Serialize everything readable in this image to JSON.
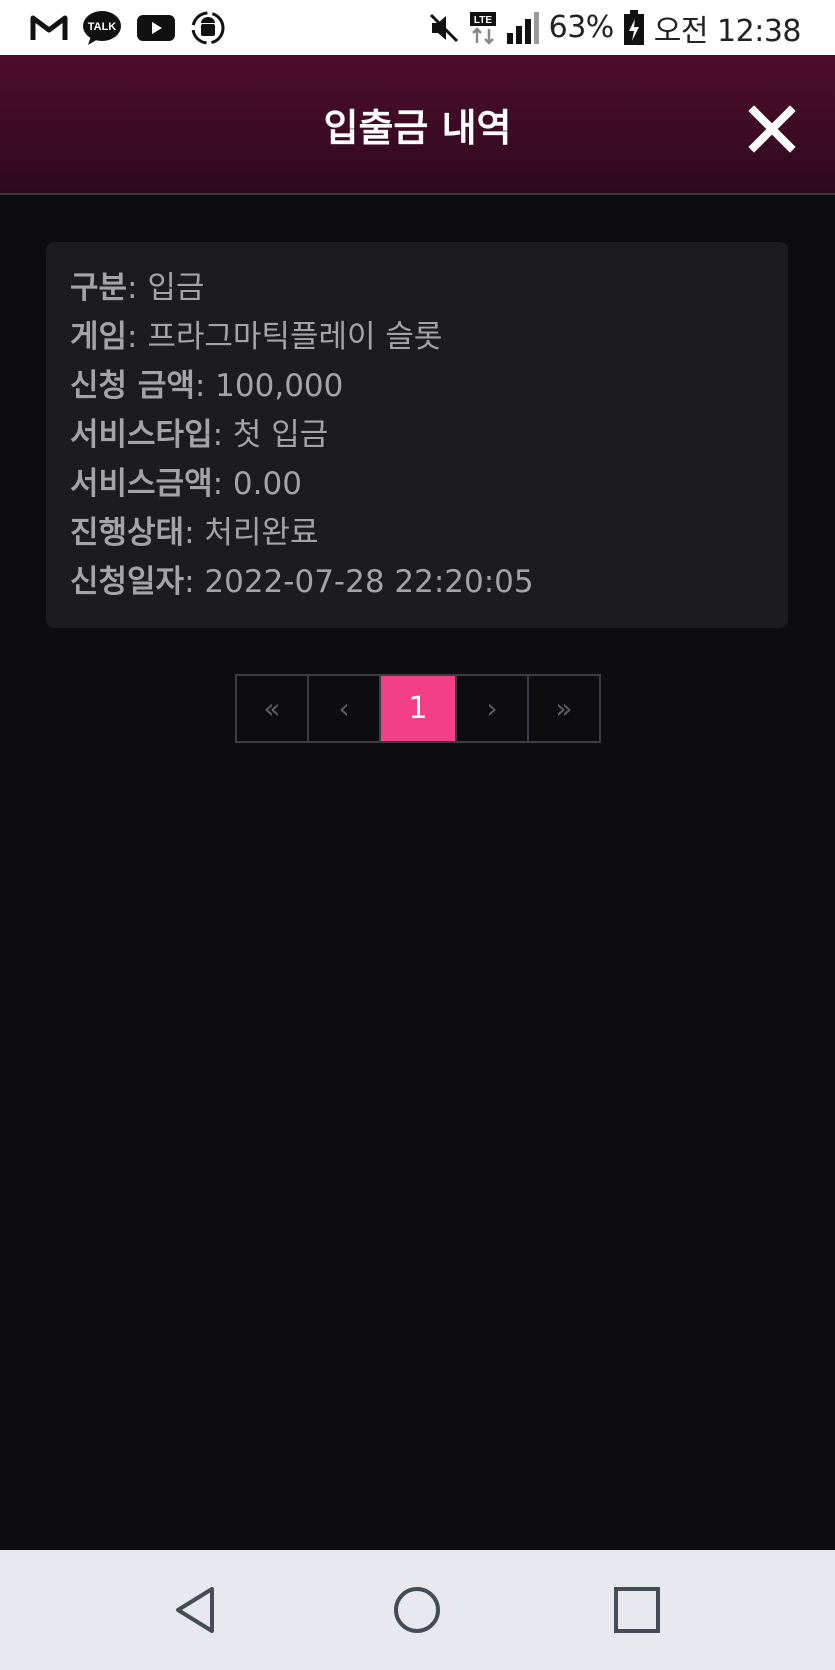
{
  "status_bar": {
    "battery": "63%",
    "time": "오전 12:38",
    "apps": [
      "gmail-icon",
      "kakaotalk-icon",
      "youtube-icon",
      "android-sync-icon"
    ],
    "talk_label": "TALK"
  },
  "header": {
    "title": "입출금 내역",
    "close_icon": "close-icon"
  },
  "details": [
    {
      "label": "구분",
      "value": ": 입금"
    },
    {
      "label": "게임",
      "value": ": 프라그마틱플레이 슬롯"
    },
    {
      "label": "신청 금액",
      "value": ": 100,000"
    },
    {
      "label": "서비스타입",
      "value": ": 첫 입금"
    },
    {
      "label": "서비스금액",
      "value": ": 0.00"
    },
    {
      "label": "진행상태",
      "value": ": 처리완료"
    },
    {
      "label": "신청일자",
      "value": ": 2022-07-28 22:20:05"
    }
  ],
  "pagination": {
    "first": "«",
    "prev": "‹",
    "current": "1",
    "next": "›",
    "last": "»"
  },
  "colors": {
    "accent": "#f23f86",
    "header_top": "#4e0c2b",
    "header_bottom": "#2e0a1d",
    "background": "#0d0d10",
    "card": "#1c1c20"
  }
}
